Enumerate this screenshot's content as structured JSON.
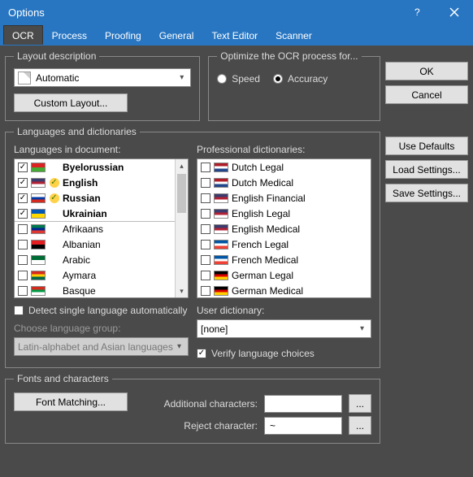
{
  "window": {
    "title": "Options"
  },
  "tabs": [
    "OCR",
    "Process",
    "Proofing",
    "General",
    "Text Editor",
    "Scanner"
  ],
  "active_tab": 0,
  "layout": {
    "groupTitle": "Layout description",
    "comboValue": "Automatic",
    "customButton": "Custom Layout..."
  },
  "optimize": {
    "groupTitle": "Optimize the OCR process for...",
    "speedLabel": "Speed",
    "accuracyLabel": "Accuracy",
    "selected": "accuracy"
  },
  "side_buttons": {
    "ok": "OK",
    "cancel": "Cancel",
    "use_defaults": "Use Defaults",
    "load_settings": "Load Settings...",
    "save_settings": "Save Settings..."
  },
  "languages": {
    "groupTitle": "Languages and dictionaries",
    "langsLabel": "Languages in document:",
    "profLabel": "Professional dictionaries:",
    "langs": [
      {
        "name": "Byelorussian",
        "checked": true,
        "dict": false,
        "bold": true,
        "flag": [
          "#d22",
          "#4a3"
        ]
      },
      {
        "name": "English",
        "checked": true,
        "dict": true,
        "bold": true,
        "flag": [
          "#3c3b6e",
          "#b22234",
          "#fff"
        ]
      },
      {
        "name": "Russian",
        "checked": true,
        "dict": true,
        "bold": true,
        "flag": [
          "#fff",
          "#0039a6",
          "#d52b1e"
        ]
      },
      {
        "name": "Ukrainian",
        "checked": true,
        "dict": false,
        "bold": true,
        "flag": [
          "#0057b7",
          "#ffd700"
        ]
      },
      {
        "name": "Afrikaans",
        "checked": false,
        "dict": false,
        "bold": false,
        "sep": true,
        "flag": [
          "#007a4d",
          "#002395",
          "#de3831"
        ]
      },
      {
        "name": "Albanian",
        "checked": false,
        "dict": false,
        "bold": false,
        "flag": [
          "#e41e20",
          "#000"
        ]
      },
      {
        "name": "Arabic",
        "checked": false,
        "dict": false,
        "bold": false,
        "flag": [
          "#006c35",
          "#fff"
        ]
      },
      {
        "name": "Aymara",
        "checked": false,
        "dict": false,
        "bold": false,
        "flag": [
          "#d52b1e",
          "#ffcd00",
          "#006847"
        ]
      },
      {
        "name": "Basque",
        "checked": false,
        "dict": false,
        "bold": false,
        "flag": [
          "#d52b1e",
          "#009b48",
          "#fff"
        ]
      }
    ],
    "prof": [
      {
        "name": "Dutch Legal",
        "checked": false,
        "flag": [
          "#ae1c28",
          "#fff",
          "#21468b"
        ]
      },
      {
        "name": "Dutch Medical",
        "checked": false,
        "flag": [
          "#ae1c28",
          "#fff",
          "#21468b"
        ]
      },
      {
        "name": "English Financial",
        "checked": false,
        "flag": [
          "#3c3b6e",
          "#b22234",
          "#fff"
        ]
      },
      {
        "name": "English Legal",
        "checked": false,
        "flag": [
          "#3c3b6e",
          "#b22234",
          "#fff"
        ]
      },
      {
        "name": "English Medical",
        "checked": false,
        "flag": [
          "#3c3b6e",
          "#b22234",
          "#fff"
        ]
      },
      {
        "name": "French Legal",
        "checked": false,
        "flag": [
          "#0055a4",
          "#fff",
          "#ef4135"
        ]
      },
      {
        "name": "French Medical",
        "checked": false,
        "flag": [
          "#0055a4",
          "#fff",
          "#ef4135"
        ]
      },
      {
        "name": "German Legal",
        "checked": false,
        "flag": [
          "#000",
          "#dd0000",
          "#ffce00"
        ]
      },
      {
        "name": "German Medical",
        "checked": false,
        "flag": [
          "#000",
          "#dd0000",
          "#ffce00"
        ]
      }
    ],
    "detectSingle": {
      "label": "Detect single language automatically",
      "checked": false
    },
    "groupLabel": "Choose language group:",
    "groupValue": "Latin-alphabet and Asian languages",
    "userDictLabel": "User dictionary:",
    "userDictValue": "[none]",
    "verify": {
      "label": "Verify language choices",
      "checked": true
    }
  },
  "fonts": {
    "groupTitle": "Fonts and characters",
    "fontMatching": "Font Matching...",
    "additionalLabel": "Additional characters:",
    "additionalValue": "",
    "rejectLabel": "Reject character:",
    "rejectValue": "~",
    "browse": "..."
  }
}
